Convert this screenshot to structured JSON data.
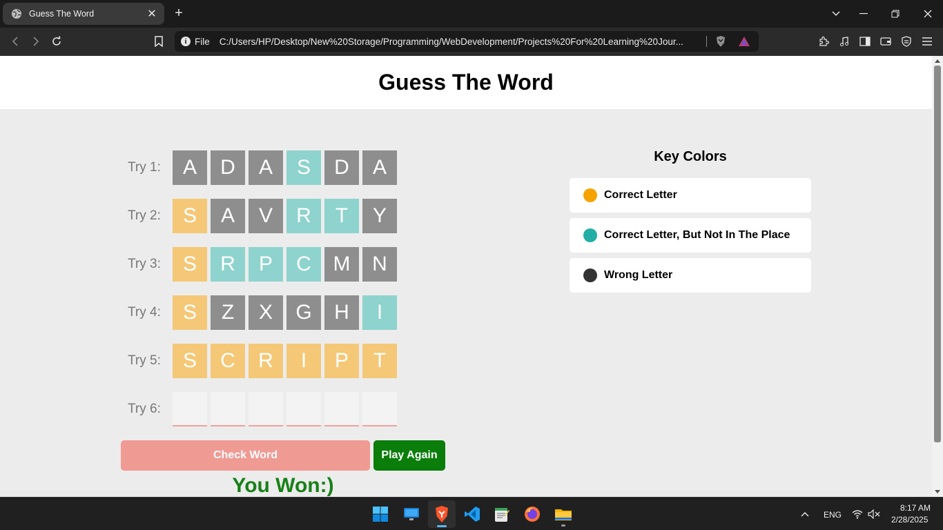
{
  "browser": {
    "tab_title": "Guess The Word",
    "address_scheme": "File",
    "address_url": "C:/Users/HP/Desktop/New%20Storage/Programming/WebDevelopment/Projects%20For%20Learning%20Jour..."
  },
  "page": {
    "title": "Guess The Word",
    "tries": [
      {
        "label": "Try 1:",
        "cells": [
          {
            "letter": "A",
            "state": "gray"
          },
          {
            "letter": "D",
            "state": "gray"
          },
          {
            "letter": "A",
            "state": "gray"
          },
          {
            "letter": "S",
            "state": "teal"
          },
          {
            "letter": "D",
            "state": "gray"
          },
          {
            "letter": "A",
            "state": "gray"
          }
        ]
      },
      {
        "label": "Try 2:",
        "cells": [
          {
            "letter": "S",
            "state": "yellow"
          },
          {
            "letter": "A",
            "state": "gray"
          },
          {
            "letter": "V",
            "state": "gray"
          },
          {
            "letter": "R",
            "state": "teal"
          },
          {
            "letter": "T",
            "state": "teal"
          },
          {
            "letter": "Y",
            "state": "gray"
          }
        ]
      },
      {
        "label": "Try 3:",
        "cells": [
          {
            "letter": "S",
            "state": "yellow"
          },
          {
            "letter": "R",
            "state": "teal"
          },
          {
            "letter": "P",
            "state": "teal"
          },
          {
            "letter": "C",
            "state": "teal"
          },
          {
            "letter": "M",
            "state": "gray"
          },
          {
            "letter": "N",
            "state": "gray"
          }
        ]
      },
      {
        "label": "Try 4:",
        "cells": [
          {
            "letter": "S",
            "state": "yellow"
          },
          {
            "letter": "Z",
            "state": "gray"
          },
          {
            "letter": "X",
            "state": "gray"
          },
          {
            "letter": "G",
            "state": "gray"
          },
          {
            "letter": "H",
            "state": "gray"
          },
          {
            "letter": "I",
            "state": "teal"
          }
        ]
      },
      {
        "label": "Try 5:",
        "cells": [
          {
            "letter": "S",
            "state": "yellow"
          },
          {
            "letter": "C",
            "state": "yellow"
          },
          {
            "letter": "R",
            "state": "yellow"
          },
          {
            "letter": "I",
            "state": "yellow"
          },
          {
            "letter": "P",
            "state": "yellow"
          },
          {
            "letter": "T",
            "state": "yellow"
          }
        ]
      },
      {
        "label": "Try 6:",
        "cells": [
          {
            "letter": "",
            "state": "empty"
          },
          {
            "letter": "",
            "state": "empty"
          },
          {
            "letter": "",
            "state": "empty"
          },
          {
            "letter": "",
            "state": "empty"
          },
          {
            "letter": "",
            "state": "empty"
          },
          {
            "letter": "",
            "state": "empty"
          }
        ]
      }
    ],
    "check_button": "Check Word",
    "play_again_button": "Play Again",
    "result_message": "You Won:)",
    "key_colors": {
      "title": "Key Colors",
      "items": [
        {
          "label": "Correct Letter",
          "color": "#f5a300"
        },
        {
          "label": "Correct Letter, But Not In The Place",
          "color": "#22aea5"
        },
        {
          "label": "Wrong Letter",
          "color": "#333333"
        }
      ]
    }
  },
  "taskbar": {
    "apps": [
      "start-icon",
      "desktop-icon",
      "brave-icon",
      "vscode-icon",
      "notepad-icon",
      "firefox-icon",
      "file-explorer-icon"
    ],
    "language": "ENG",
    "time": "8:17 AM",
    "date": "2/28/2025"
  }
}
